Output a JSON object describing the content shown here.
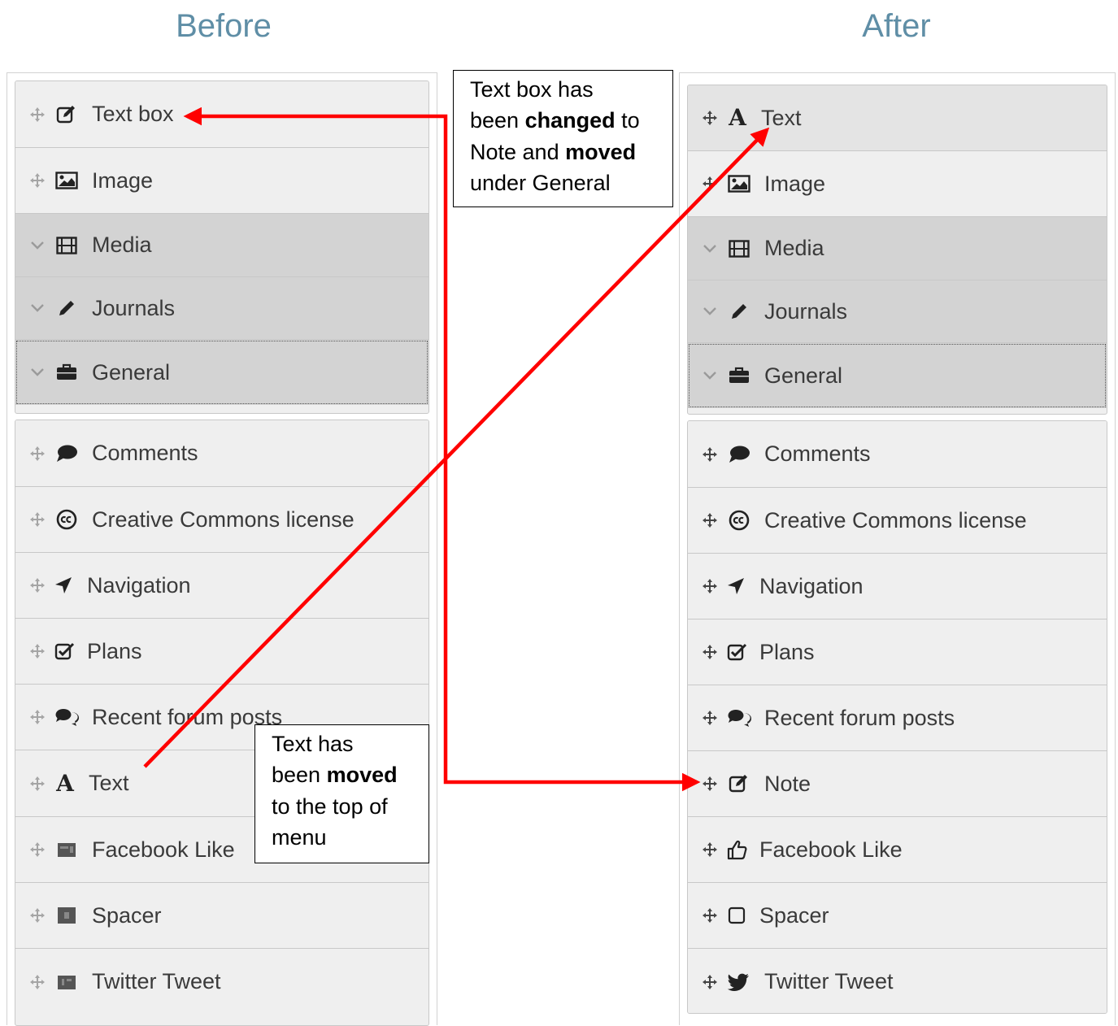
{
  "headings": {
    "before": "Before",
    "after": "After"
  },
  "before": {
    "top_group": [
      {
        "label": "Text box",
        "icon": "edit-icon"
      },
      {
        "label": "Image",
        "icon": "image-icon"
      },
      {
        "label": "Media",
        "icon": "film-icon"
      },
      {
        "label": "Journals",
        "icon": "pencil-icon"
      },
      {
        "label": "General",
        "icon": "briefcase-icon"
      }
    ],
    "bottom_group": [
      {
        "label": "Comments",
        "icon": "comment-icon"
      },
      {
        "label": "Creative Commons license",
        "icon": "cc-icon"
      },
      {
        "label": "Navigation",
        "icon": "location-arrow-icon"
      },
      {
        "label": "Plans",
        "icon": "checkbox-icon"
      },
      {
        "label": "Recent forum posts",
        "icon": "comments-icon"
      },
      {
        "label": "Text",
        "icon": "text-a-icon"
      },
      {
        "label": "Facebook Like",
        "icon": "facebook-placeholder-icon"
      },
      {
        "label": "Spacer",
        "icon": "spacer-placeholder-icon"
      },
      {
        "label": "Twitter Tweet",
        "icon": "twitter-placeholder-icon"
      }
    ]
  },
  "after": {
    "top_group": [
      {
        "label": "Text",
        "icon": "text-a-icon"
      },
      {
        "label": "Image",
        "icon": "image-icon"
      },
      {
        "label": "Media",
        "icon": "film-icon"
      },
      {
        "label": "Journals",
        "icon": "pencil-icon"
      },
      {
        "label": "General",
        "icon": "briefcase-icon"
      }
    ],
    "bottom_group": [
      {
        "label": "Comments",
        "icon": "comment-icon"
      },
      {
        "label": "Creative Commons license",
        "icon": "cc-icon"
      },
      {
        "label": "Navigation",
        "icon": "location-arrow-icon"
      },
      {
        "label": "Plans",
        "icon": "checkbox-icon"
      },
      {
        "label": "Recent forum posts",
        "icon": "comments-icon"
      },
      {
        "label": "Note",
        "icon": "edit-icon"
      },
      {
        "label": "Facebook Like",
        "icon": "thumbs-up-icon"
      },
      {
        "label": "Spacer",
        "icon": "square-icon"
      },
      {
        "label": "Twitter Tweet",
        "icon": "twitter-icon"
      }
    ]
  },
  "callouts": {
    "top": {
      "l1": "Text box has",
      "l2a": "been ",
      "l2b": "changed",
      "l2c": " to",
      "l3a": "Note and ",
      "l3b": "moved",
      "l4": "under General"
    },
    "bottom": {
      "l1": "Text has",
      "l2a": "been ",
      "l2b": "moved",
      "l3": "to the top of",
      "l4": "menu"
    }
  },
  "colors": {
    "arrow": "#ff0000",
    "heading": "#5f8ea6",
    "category_bg": "#d3d3d3",
    "item_bg": "#efefef"
  }
}
